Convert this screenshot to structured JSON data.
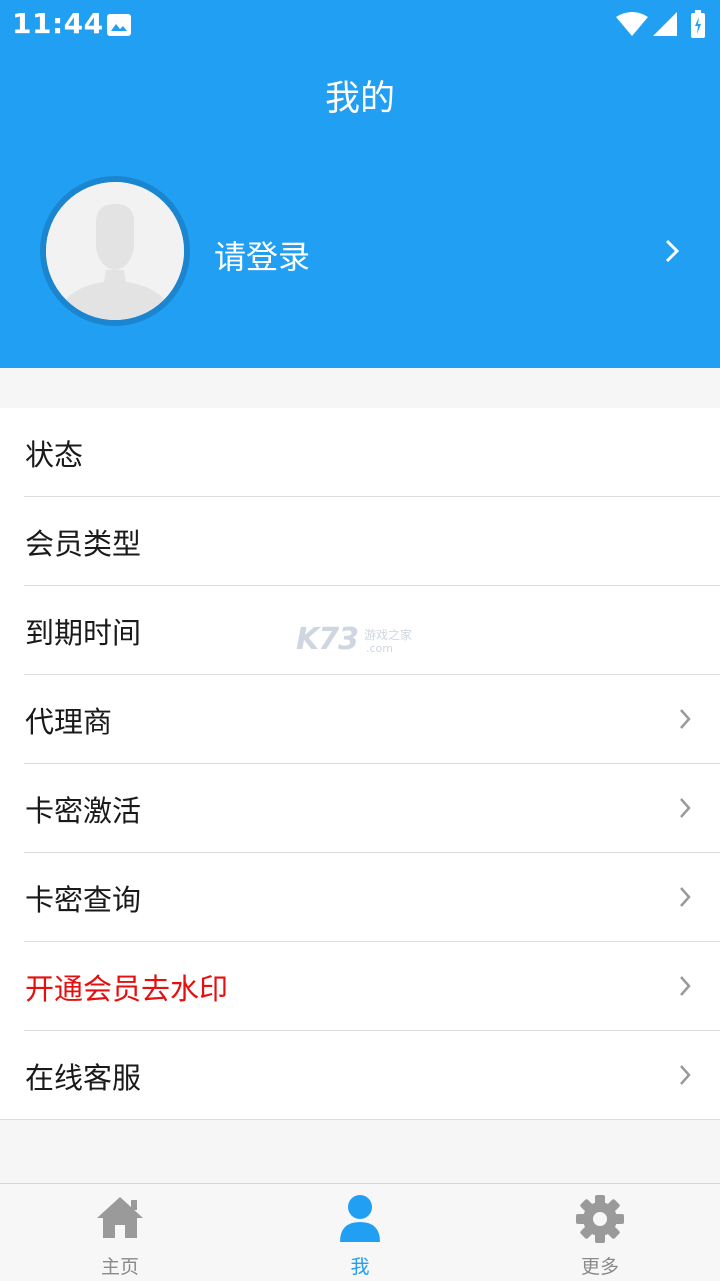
{
  "status_bar": {
    "time": "11:44"
  },
  "header": {
    "title": "我的",
    "login_label": "请登录"
  },
  "menu": {
    "items": [
      {
        "label": "状态",
        "chevron": false,
        "highlight": false
      },
      {
        "label": "会员类型",
        "chevron": false,
        "highlight": false
      },
      {
        "label": "到期时间",
        "chevron": false,
        "highlight": false
      },
      {
        "label": "代理商",
        "chevron": true,
        "highlight": false
      },
      {
        "label": "卡密激活",
        "chevron": true,
        "highlight": false
      },
      {
        "label": "卡密查询",
        "chevron": true,
        "highlight": false
      },
      {
        "label": "开通会员去水印",
        "chevron": true,
        "highlight": true
      },
      {
        "label": "在线客服",
        "chevron": true,
        "highlight": false
      }
    ]
  },
  "watermark": {
    "brand": "K73",
    "tagline": "游戏之家",
    "domain": ".com"
  },
  "tabbar": {
    "tabs": [
      {
        "label": "主页",
        "icon": "home-icon",
        "active": false
      },
      {
        "label": "我",
        "icon": "person-icon",
        "active": true
      },
      {
        "label": "更多",
        "icon": "gear-icon",
        "active": false
      }
    ]
  },
  "colors": {
    "primary": "#219ff2",
    "highlight": "#e50f0f",
    "inactive": "#8a8a8a"
  }
}
